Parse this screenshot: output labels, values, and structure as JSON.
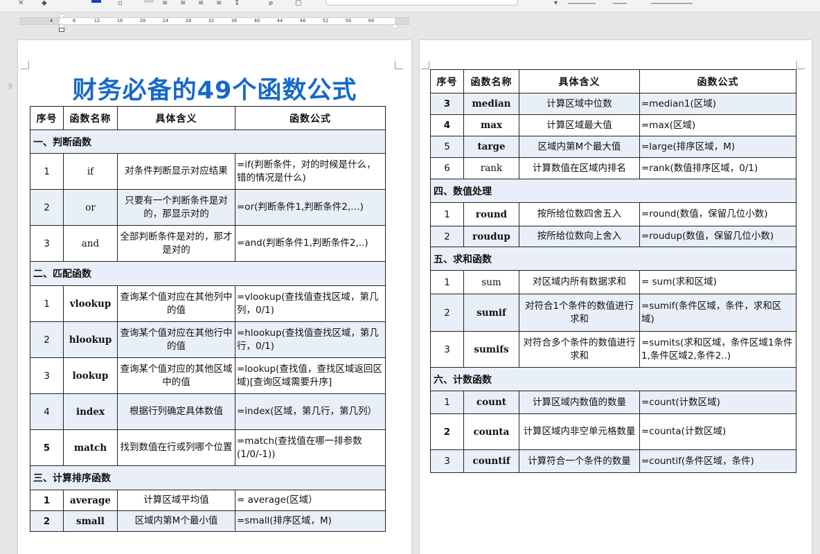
{
  "ruler": {
    "ticks": [
      "4",
      "8",
      "12",
      "16",
      "20",
      "24",
      "28",
      "32",
      "36",
      "40",
      "44",
      "48",
      "52",
      "56",
      "60"
    ]
  },
  "title": "财务必备的49个函数公式",
  "headers": [
    "序号",
    "函数名称",
    "具体含义",
    "函数公式"
  ],
  "page1_rows": [
    {
      "section": "一、判断函数"
    },
    {
      "no": "1",
      "name": "if",
      "meaning": "对条件判断显示对应结果",
      "formula": "=if(判断条件，对的时候是什么，错的情况是什么)"
    },
    {
      "no": "2",
      "name": "or",
      "meaning": "只要有一个判断条件是对的，那显示对的",
      "formula": "=or(判断条件1,判断条件2,…)"
    },
    {
      "no": "3",
      "name": "and",
      "meaning": "全部判断条件是对的，那才是对的",
      "formula": "=and(判断条件1,判断条件2,..)"
    },
    {
      "section": "二、匹配函数"
    },
    {
      "no": "1",
      "name": "vlookup",
      "meaning": "查询某个值对应在其他列中的值",
      "formula": "=vlookup(查找值查找区域，第几列，0/1)"
    },
    {
      "no": "2",
      "name": "hlookup",
      "meaning": "查询某个值对应在其他行中的值",
      "formula": "=hlookup(查找值查找区域，第几行，0/1)"
    },
    {
      "no": "3",
      "name": "lookup",
      "meaning": "查询某个值对应的其他区域中的值",
      "formula": "=lookup(查找值，查找区域返回区域)[查询区域需要升序]"
    },
    {
      "no": "4",
      "name": "index",
      "meaning": "根据行列确定具体数值",
      "formula": "=index(区域，第几行，第几列）"
    },
    {
      "no": "5",
      "name": "match",
      "meaning": "找到数值在行或列哪个位置",
      "formula": "=match(查找值在哪一排参数(1/0/-1))"
    },
    {
      "section": "三、计算排序函数"
    },
    {
      "no": "1",
      "name": "average",
      "meaning": "计算区域平均值",
      "formula": "= average(区域）"
    },
    {
      "no": "2",
      "name": "small",
      "meaning": "区域内第M个最小值",
      "formula": "=small(排序区域，M)"
    }
  ],
  "page2_rows": [
    {
      "no": "3",
      "name": "median",
      "meaning": "计算区域中位数",
      "formula": "=median1(区域)"
    },
    {
      "no": "4",
      "name": "max",
      "meaning": "计算区域最大值",
      "formula": "=max(区域)"
    },
    {
      "no": "5",
      "name": "targe",
      "meaning": "区域内第M个最大值",
      "formula": "=large(排序区域，M)"
    },
    {
      "no": "6",
      "name": "rank",
      "meaning": "计算数值在区域内排名",
      "formula": "=rank(数值排序区域，0/1)"
    },
    {
      "section": "四、数值处理"
    },
    {
      "no": "1",
      "name": "round",
      "meaning": "按所给位数四舍五入",
      "formula": "=round(数值，保留几位小数)"
    },
    {
      "no": "2",
      "name": "roudup",
      "meaning": "按所给位数向上舍入",
      "formula": "=roudup(数值，保留几位小数)"
    },
    {
      "section": "五、求和函数"
    },
    {
      "no": "1",
      "name": "sum",
      "meaning": "对区域内所有数据求和",
      "formula": "= sum(求和区域)"
    },
    {
      "no": "2",
      "name": "sumif",
      "meaning": "对符合1个条件的数值进行求和",
      "formula": "=sumif(条件区域，条件，求和区域)"
    },
    {
      "no": "3",
      "name": "sumifs",
      "meaning": "对符合多个条件的数值进行求和",
      "formula": "=sumits(求和区域，条件区域1条件1,条件区域2,条件2..)"
    },
    {
      "section": "六、计数函数"
    },
    {
      "no": "1",
      "name": "count",
      "meaning": "计算区域内数值的数量",
      "formula": "=count(计数区域)"
    },
    {
      "no": "2",
      "name": "counta",
      "meaning": "计算区域内非空单元格数量",
      "formula": "=counta(计数区域)"
    },
    {
      "no": "3",
      "name": "countif",
      "meaning": "计算符合一个条件的数量",
      "formula": "=countif(条件区域，条件)"
    }
  ]
}
